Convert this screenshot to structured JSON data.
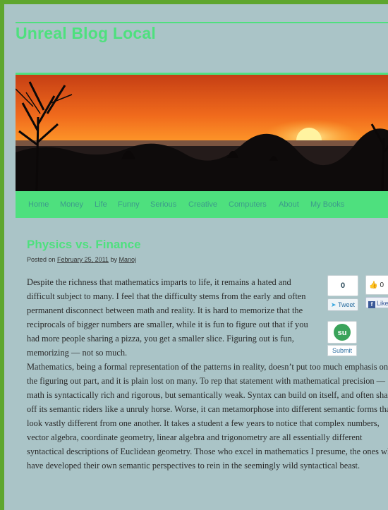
{
  "site": {
    "title": "Unreal Blog Local"
  },
  "nav": [
    "Home",
    "Money",
    "Life",
    "Funny",
    "Serious",
    "Creative",
    "Computers",
    "About",
    "My Books"
  ],
  "post": {
    "title": "Physics vs. Finance",
    "posted_on": "Posted on",
    "date": "February 25, 2011",
    "by": "by",
    "author": "Manoj",
    "p1": "Despite the richness that mathematics imparts to life, it remains a hated and difficult subject to many. I feel that the difficulty stems from the early and often permanent disconnect between math and reality. It is hard to memorize that the reciprocals of bigger numbers are smaller, while it is fun to figure out that if you had more people sharing a pizza, you get a smaller slice. Figuring out is fun, memorizing — not so much.",
    "p2": "Mathematics, being a formal representation of the patterns in reality, doesn’t put too much emphasis on the figuring out part, and it is plain lost on many. To rep that statement with mathematical precision — math is syntactically rich and rigorous, but semantically weak. Syntax can build on itself, and often shake off its semantic riders like a unruly horse. Worse, it can metamorphose into different semantic forms that look vastly different from one another. It takes a student a few years to notice that complex numbers, vector algebra, coordinate geometry, linear algebra and trigonometry are all essentially different syntactical descriptions of Euclidean geometry. Those who excel in mathematics I presume, the ones who have developed their own semantic perspectives to rein in the seemingly wild syntactical beast."
  },
  "social": {
    "tweet_count": "0",
    "tweet_label": "Tweet",
    "stumble_label": "Submit",
    "fb_count": "0",
    "fb_label": "Like"
  }
}
